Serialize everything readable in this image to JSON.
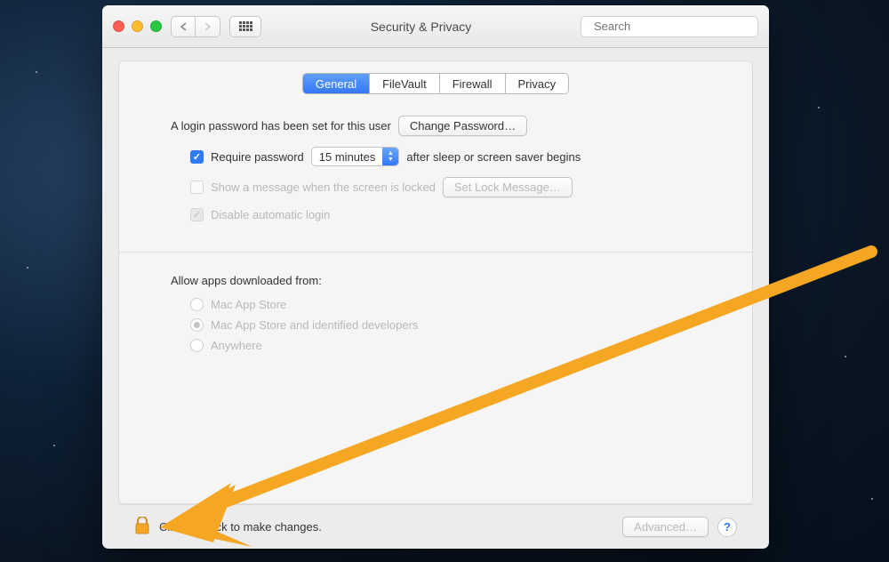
{
  "window": {
    "title": "Security & Privacy",
    "search_placeholder": "Search"
  },
  "tabs": [
    "General",
    "FileVault",
    "Firewall",
    "Privacy"
  ],
  "active_tab": 0,
  "login_section": {
    "password_set_text": "A login password has been set for this user",
    "change_password_btn": "Change Password…",
    "require_password_label_pre": "Require password",
    "require_password_delay": "15 minutes",
    "require_password_label_post": "after sleep or screen saver begins",
    "require_password_checked": true,
    "show_message_label": "Show a message when the screen is locked",
    "show_message_checked": false,
    "set_lock_message_btn": "Set Lock Message…",
    "disable_auto_login_label": "Disable automatic login",
    "disable_auto_login_checked": true
  },
  "allow_section": {
    "heading": "Allow apps downloaded from:",
    "options": [
      "Mac App Store",
      "Mac App Store and identified developers",
      "Anywhere"
    ],
    "selected_index": 1
  },
  "footer": {
    "lock_text": "Click the lock to make changes.",
    "advanced_btn": "Advanced…"
  }
}
